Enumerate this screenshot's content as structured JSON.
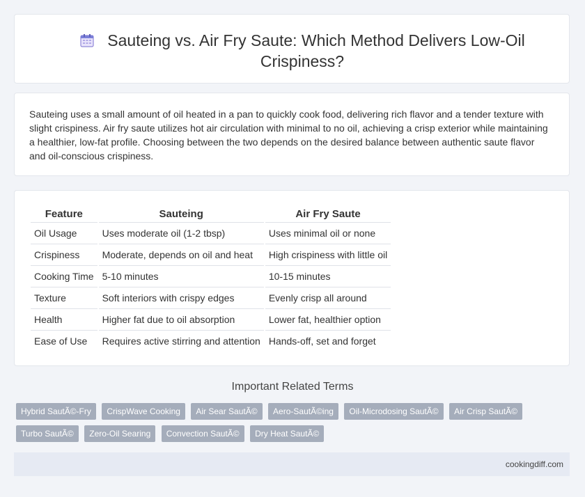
{
  "header": {
    "title": "Sauteing vs. Air Fry Saute: Which Method Delivers Low-Oil Crispiness?",
    "icon": "calendar-icon"
  },
  "summary": {
    "text": "Sauteing uses a small amount of oil heated in a pan to quickly cook food, delivering rich flavor and a tender texture with slight crispiness. Air fry saute utilizes hot air circulation with minimal to no oil, achieving a crisp exterior while maintaining a healthier, low-fat profile. Choosing between the two depends on the desired balance between authentic saute flavor and oil-conscious crispiness."
  },
  "table": {
    "headers": [
      "Feature",
      "Sauteing",
      "Air Fry Saute"
    ],
    "rows": [
      [
        "Oil Usage",
        "Uses moderate oil (1-2 tbsp)",
        "Uses minimal oil or none"
      ],
      [
        "Crispiness",
        "Moderate, depends on oil and heat",
        "High crispiness with little oil"
      ],
      [
        "Cooking Time",
        "5-10 minutes",
        "10-15 minutes"
      ],
      [
        "Texture",
        "Soft interiors with crispy edges",
        "Evenly crisp all around"
      ],
      [
        "Health",
        "Higher fat due to oil absorption",
        "Lower fat, healthier option"
      ],
      [
        "Ease of Use",
        "Requires active stirring and attention",
        "Hands-off, set and forget"
      ]
    ]
  },
  "related": {
    "title": "Important Related Terms",
    "tags": [
      "Hybrid SautÃ©-Fry",
      "CrispWave Cooking",
      "Air Sear SautÃ©",
      "Aero-SautÃ©ing",
      "Oil-Microdosing SautÃ©",
      "Air Crisp SautÃ©",
      "Turbo SautÃ©",
      "Zero-Oil Searing",
      "Convection SautÃ©",
      "Dry Heat SautÃ©"
    ]
  },
  "footer": {
    "site": "cookingdiff.com"
  },
  "colors": {
    "background": "#f2f4f8",
    "tag": "#a5adbb",
    "footer": "#e6eaf3"
  }
}
